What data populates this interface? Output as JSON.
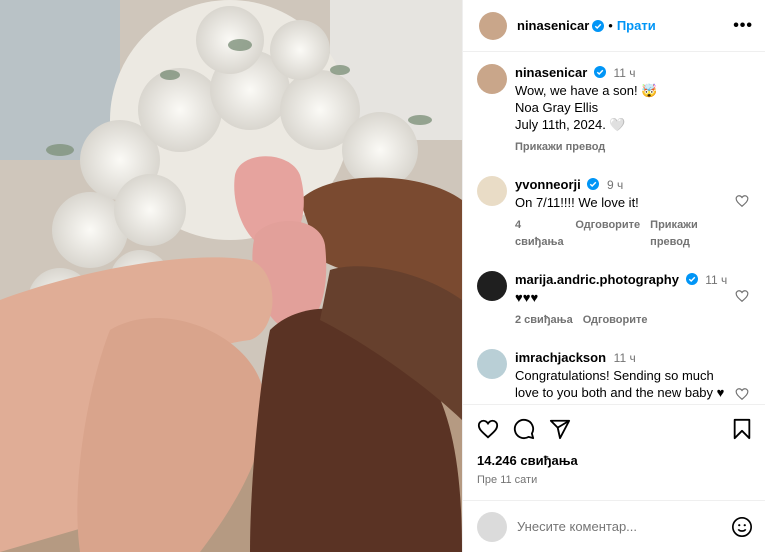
{
  "post": {
    "author": "ninasenicar",
    "follow_label": "Прати",
    "caption": {
      "time": "11 ч",
      "line1": "Wow, we have a son! 🤯",
      "line2": "Noa Gray Ellis",
      "line3": "July 11th, 2024. 🤍",
      "translate": "Прикажи превод"
    },
    "comments": [
      {
        "user": "yvonneorji",
        "time": "9 ч",
        "text": "On 7/11!!!! We love it!",
        "likes": "4 свиђања",
        "reply": "Одговорите",
        "translate": "Прикажи превод"
      },
      {
        "user": "marija.andric.photography",
        "time": "11 ч",
        "text": "♥♥♥",
        "likes": "2 свиђања",
        "reply": "Одговорите"
      },
      {
        "user": "imrachjackson",
        "time": "11 ч",
        "text": "Congratulations! Sending so much love to you both and the new baby ♥ can't wait to meet the lil stud muffin."
      }
    ],
    "likes_count": "14.246 свиђања",
    "posted_ago": "Пре 11 сати",
    "comment_placeholder": "Унесите коментар..."
  },
  "icons": [
    "like-icon",
    "comment-icon",
    "share-icon",
    "save-icon",
    "emoji-icon",
    "more-icon",
    "verified-badge-icon"
  ],
  "colors": {
    "accent": "#0095f6",
    "muted": "#737373",
    "verified": "#0095f6"
  }
}
